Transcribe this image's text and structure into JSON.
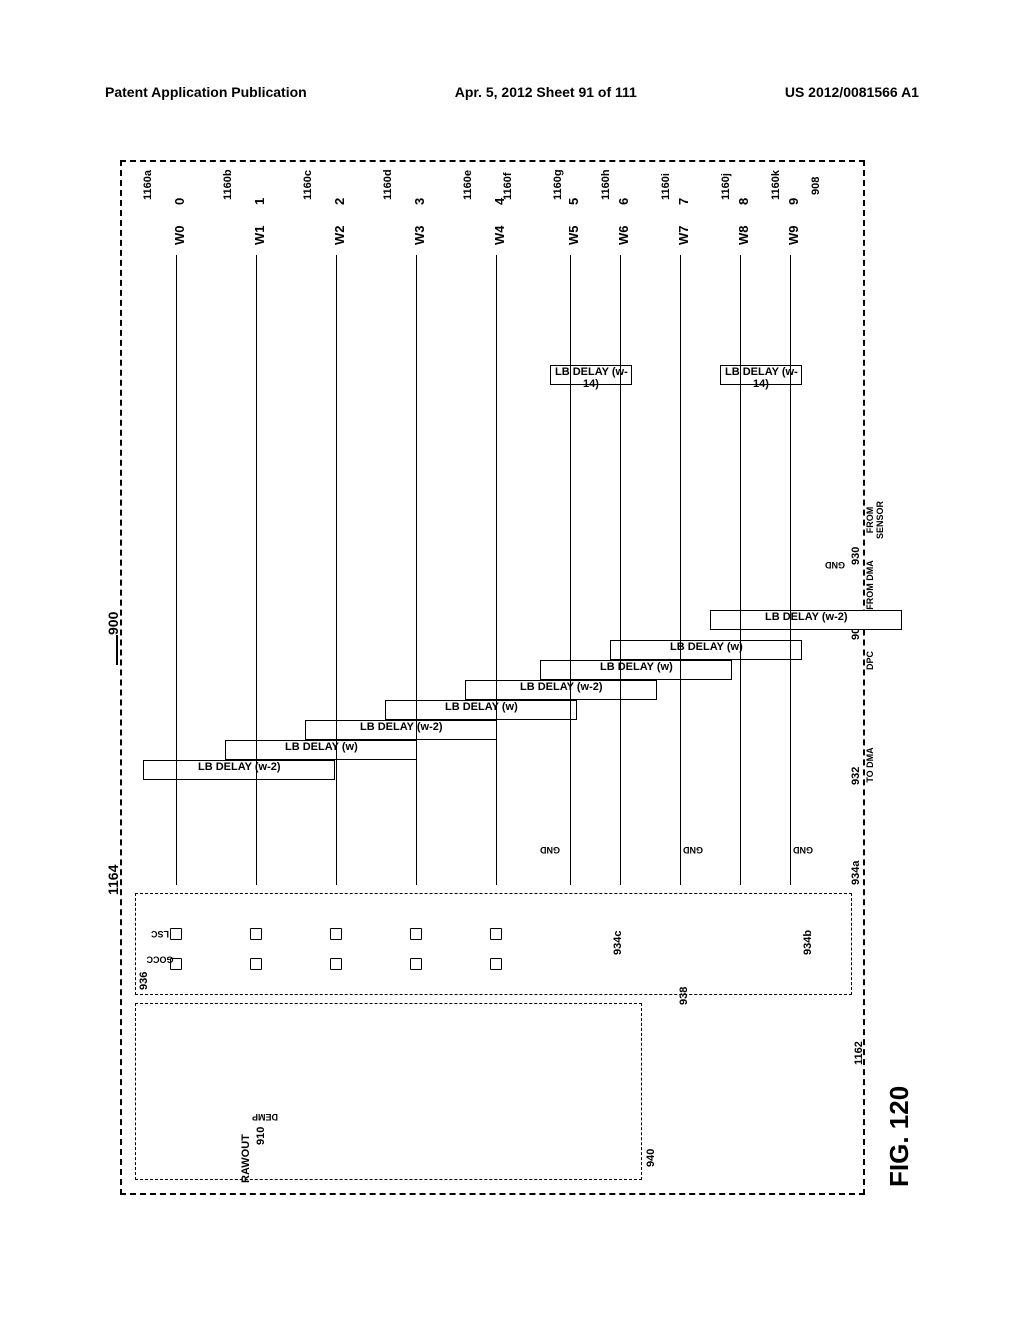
{
  "header": {
    "left": "Patent Application Publication",
    "center": "Apr. 5, 2012  Sheet 91 of 111",
    "right": "US 2012/0081566 A1"
  },
  "figure": {
    "label": "FIG. 120"
  },
  "refs": {
    "r900": "900",
    "r908a": "908",
    "r908b": "908",
    "r910": "910",
    "r930": "930",
    "r932": "932",
    "r934a": "934a",
    "r934b": "934b",
    "r934c": "934c",
    "r936": "936",
    "r938": "938",
    "r940": "940",
    "r1162": "1162",
    "r1164": "1164"
  },
  "lanes": {
    "l0": "1160a",
    "l1": "1160b",
    "l2": "1160c",
    "l3": "1160d",
    "l4": "1160e",
    "l5": "1160f",
    "l6": "1160g",
    "l7": "1160h",
    "l8": "1160i",
    "l9": "1160j",
    "l10": "1160k"
  },
  "w": {
    "w0": "W0",
    "w1": "W1",
    "w2": "W2",
    "w3": "W3",
    "w4": "W4",
    "w5": "W5",
    "w6": "W6",
    "w7": "W7",
    "w8": "W8",
    "w9": "W9"
  },
  "idx": {
    "n0": "0",
    "n1": "1",
    "n2": "2",
    "n3": "3",
    "n4": "4",
    "n5": "5",
    "n6": "6",
    "n7": "7",
    "n8": "8",
    "n9": "9"
  },
  "lb": {
    "w2": "LB DELAY (w-2)",
    "w": "LB DELAY (w)",
    "w14": "LB DELAY (w-14)"
  },
  "text": {
    "rawout": "RAWOUT",
    "from_sensor": "FROM SENSOR",
    "from_dma": "FROM DMA",
    "to_dma": "TO DMA",
    "dpc": "DPC",
    "lsc": "LSC",
    "gocc": "GOCC",
    "gnd": "GND",
    "demp": "DEMP"
  },
  "chart_data": {
    "type": "diagram",
    "title": "FIG. 120",
    "description": "Block diagram / signal flow: multiple LB DELAY line buffers feeding lanes W0–W9 (refs 1160a–1160k) through processing blocks (DPC, LSC, GOCC, GND) with inputs FROM SENSOR / FROM DMA and outputs RAWOUT / TO DMA.",
    "outer_ref": "900",
    "lanes": [
      {
        "ref": "1160a",
        "w": "W0",
        "index": 0
      },
      {
        "ref": "1160b",
        "w": "W1",
        "index": 1
      },
      {
        "ref": "1160c",
        "w": "W2",
        "index": 2
      },
      {
        "ref": "1160d",
        "w": "W3",
        "index": 3
      },
      {
        "ref": "1160e",
        "w": "W4",
        "index": 4
      },
      {
        "ref": "1160f",
        "w": null,
        "index": 4
      },
      {
        "ref": "1160g",
        "w": "W5",
        "index": 5
      },
      {
        "ref": "1160h",
        "w": "W6",
        "index": 6
      },
      {
        "ref": "1160i",
        "w": "W7",
        "index": 7
      },
      {
        "ref": "1160j",
        "w": "W8",
        "index": 8
      },
      {
        "ref": "1160k",
        "w": "W9",
        "index": 9
      }
    ],
    "delay_blocks": [
      "LB DELAY (w-2)",
      "LB DELAY (w)",
      "LB DELAY (w-14)"
    ],
    "processing_blocks": [
      "DPC",
      "LSC",
      "GOCC",
      "GND",
      "DEMP"
    ],
    "io": {
      "inputs": [
        "FROM SENSOR",
        "FROM DMA"
      ],
      "outputs": [
        "RAWOUT",
        "TO DMA"
      ]
    },
    "internal_refs": [
      "908",
      "910",
      "930",
      "932",
      "934a",
      "934b",
      "934c",
      "936",
      "938",
      "940",
      "1162",
      "1164"
    ]
  }
}
